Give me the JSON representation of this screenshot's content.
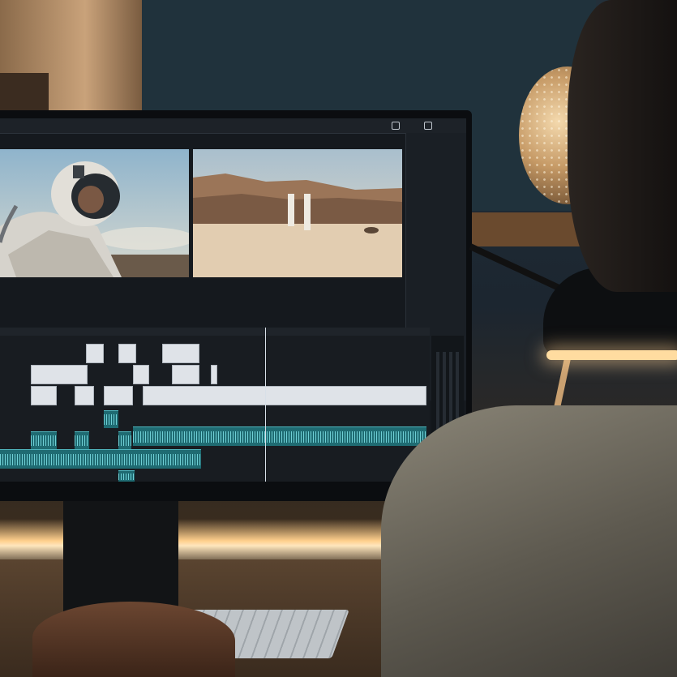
{
  "app": {
    "source_clip_name": "",
    "source_mode": "",
    "program_sequence": "",
    "top_right_buttons": [
      "",
      ""
    ],
    "inspector_title": "",
    "inspector_rows": [
      "",
      "",
      "",
      "",
      "",
      "",
      "",
      "",
      "",
      ""
    ],
    "source_transport_label": "",
    "program_transport_label": ""
  },
  "scene": {
    "objects": [
      "monitor",
      "video-editing-software",
      "astronaut-frame",
      "desert-frame",
      "timeline",
      "keyboard",
      "hand",
      "editor-person",
      "perforated-globe-lamp",
      "desk-lamp",
      "microphone-arm"
    ]
  },
  "colors": {
    "video_clip": "#dfe3e8",
    "audio_clip": "#1f6b72",
    "audio_waveform": "#6fd0d6",
    "ui_background": "#15191e",
    "warm_light": "#ffdca0"
  }
}
